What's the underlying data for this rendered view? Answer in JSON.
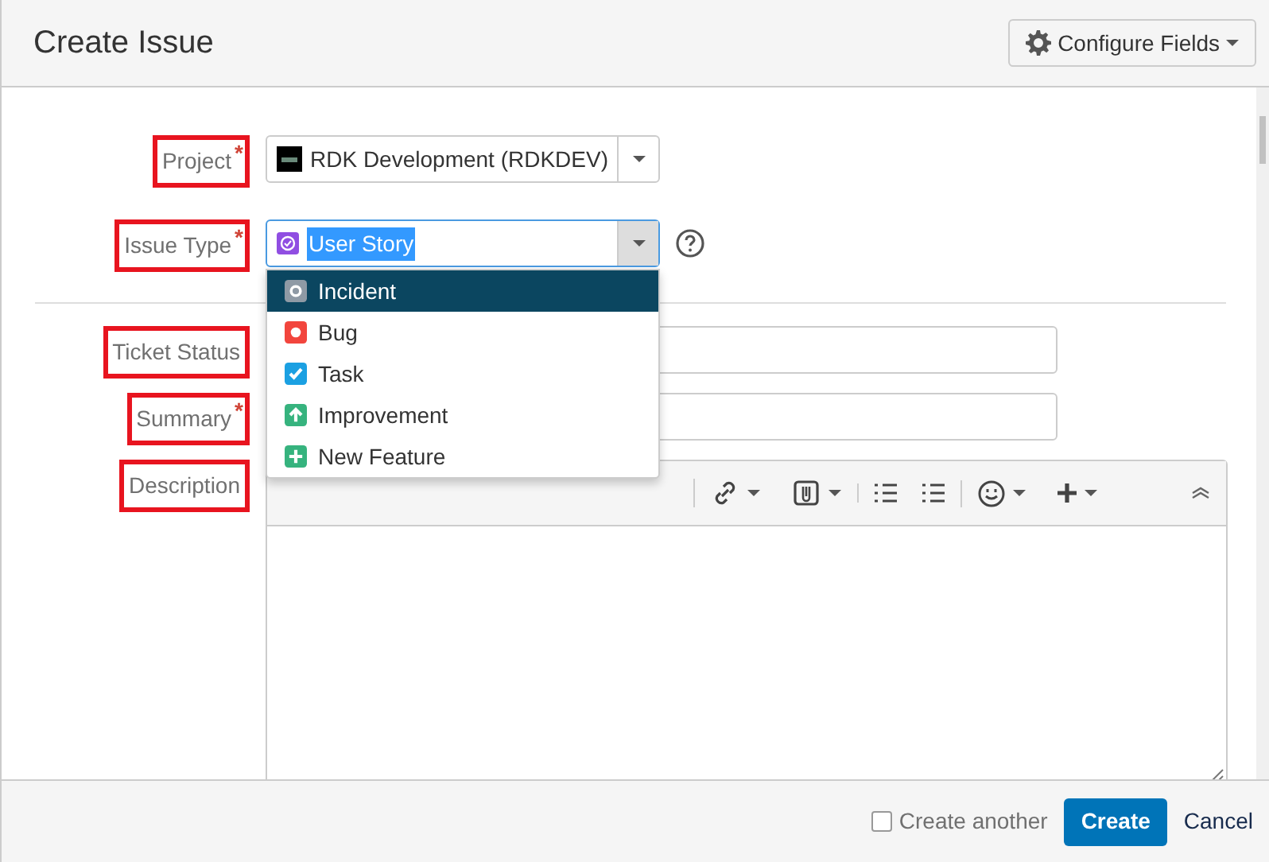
{
  "dialog": {
    "title": "Create Issue",
    "configure_button": "Configure Fields"
  },
  "fields": [
    {
      "label": "Project",
      "required_mark": "*",
      "kind": "select",
      "value": "RDK Development (RDKDEV)"
    },
    {
      "label": "Issue Type",
      "required_mark": "*",
      "kind": "select-focused",
      "value": "User Story"
    },
    {
      "label": "Ticket Status",
      "kind": "text"
    },
    {
      "label": "Summary",
      "required_mark": "*",
      "kind": "text"
    },
    {
      "label": "Description",
      "kind": "editor"
    }
  ],
  "issue_type_menu": [
    {
      "label": "Incident",
      "selected": true,
      "color": "#8f9aa5",
      "kind": "circle"
    },
    {
      "label": "Bug",
      "selected": false,
      "color": "#f2453d",
      "kind": "dot"
    },
    {
      "label": "Task",
      "selected": false,
      "color": "#1ba0e2",
      "kind": "check"
    },
    {
      "label": "Improvement",
      "selected": false,
      "color": "#36b37e",
      "kind": "arrow"
    },
    {
      "label": "New Feature",
      "selected": false,
      "color": "#36b37e",
      "kind": "plus"
    }
  ],
  "footer": {
    "create_another": {
      "label": "Create another",
      "checked": false
    },
    "create_button": "Create",
    "cancel_link": "Cancel"
  }
}
